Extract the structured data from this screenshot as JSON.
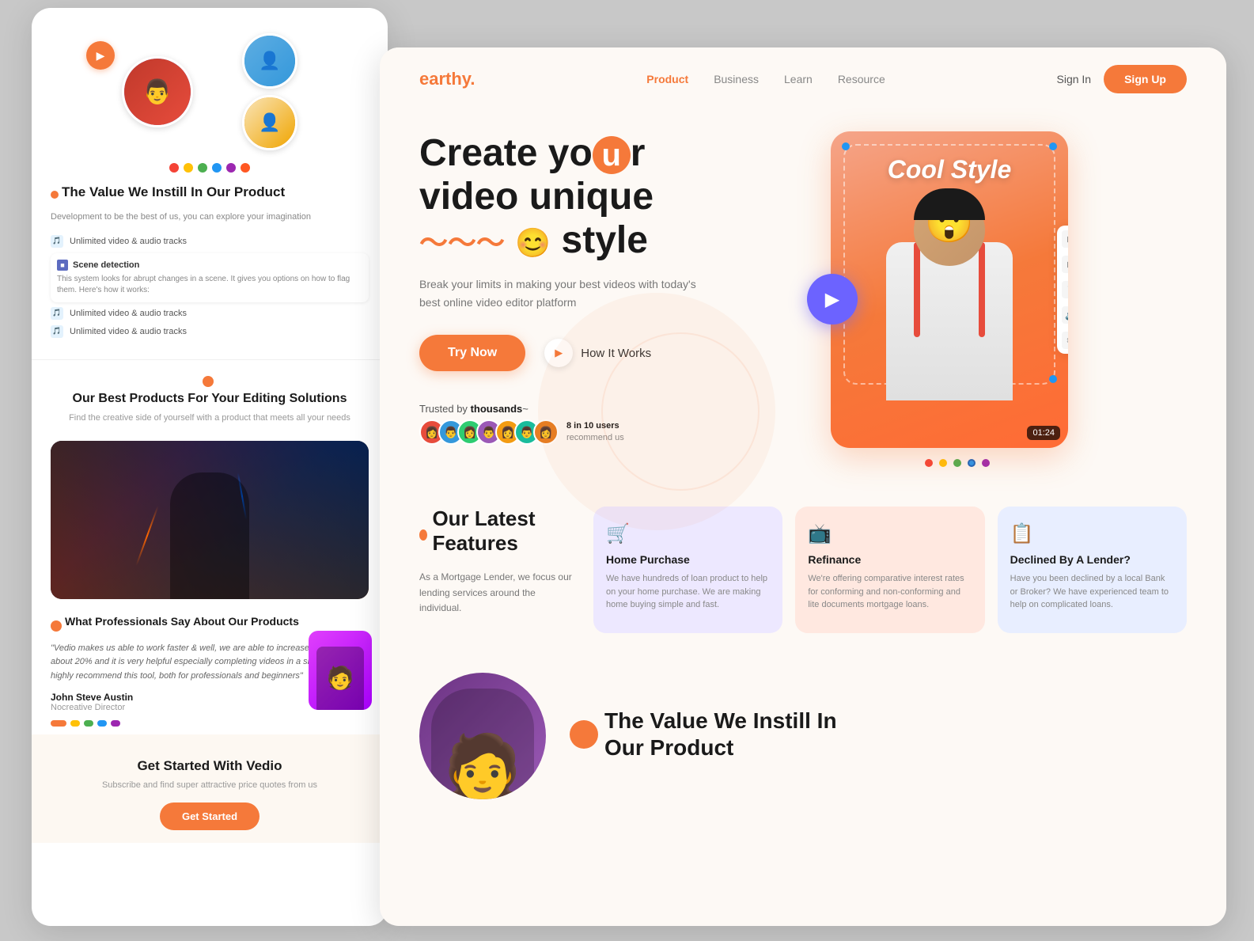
{
  "left_card": {
    "section1": {
      "title": "The Value We Instill In Our Product",
      "subtitle": "Development to be the best of us, you can explore your imagination",
      "features": [
        "Unlimited video & audio tracks",
        "Scene detection",
        "Unlimited video & audio tracks",
        "Unlimited video & audio tracks"
      ],
      "scene_detection_desc": "This system looks for abrupt changes in a scene. It gives you options on how to flag them. Here's how it works:"
    },
    "section2": {
      "title": "Our Best Products For Your Editing Solutions",
      "subtitle": "Find the creative side of yourself with a product that meets all your needs"
    },
    "testimonial": {
      "title": "What Professionals Say About Our Products",
      "quote": "\"Vedio makes us able to work faster & well, we are able to increase our time by about 20% and it is very helpful especially completing videos in a short time, we highly recommend this tool, both for professionals and beginners\"",
      "author": "John Steve Austin",
      "role": "Nocreative Director"
    },
    "bottom": {
      "title": "Get Started With Vedio",
      "subtitle": "Subscribe and find super attractive price quotes from us",
      "cta_label": "Get Started"
    }
  },
  "right_card": {
    "navbar": {
      "logo": "earthy",
      "logo_dot": ".",
      "links": [
        "Product",
        "Business",
        "Learn",
        "Resource"
      ],
      "active_link": "Product",
      "signin_label": "Sign In",
      "signup_label": "Sign Up"
    },
    "hero": {
      "title_line1": "Create your",
      "title_highlight_char": "u",
      "title_line2": "video unique",
      "title_line3": "style",
      "description": "Break your limits in making your best videos with today's best online video editor platform",
      "try_label": "Try Now",
      "how_label": "How It Works",
      "trusted_text": "Trusted by",
      "trusted_bold": "thousands",
      "recommend_text": "8 in 10 users recommend us",
      "cool_style_text": "Cool Style",
      "duration": "01:24"
    },
    "features": {
      "badge_label": "Our Latest Features",
      "description": "As a Mortgage Lender, we focus our lending services around the individual.",
      "cards": [
        {
          "icon": "🛒",
          "title": "Home Purchase",
          "text": "We have hundreds of loan product to help on your home purchase. We are making home buying simple and fast."
        },
        {
          "icon": "📺",
          "title": "Refinance",
          "text": "We're offering comparative interest rates for conforming and non-conforming and lite documents mortgage loans."
        },
        {
          "icon": "📋",
          "title": "Declined By A Lender?",
          "text": "Have you been declined by a local Bank or Broker? We have experienced team to help on complicated loans."
        }
      ]
    },
    "bottom_section": {
      "title_line1": "The Value We Instill In",
      "title_line2": "Our Product"
    }
  }
}
